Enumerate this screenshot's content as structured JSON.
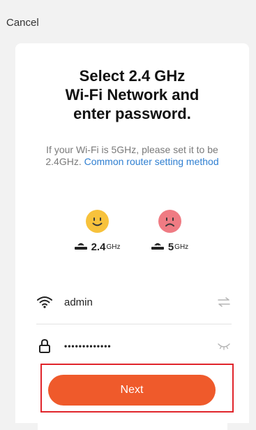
{
  "header": {
    "cancel_label": "Cancel"
  },
  "card": {
    "title_line1": "Select 2.4 GHz",
    "title_line2": "Wi-Fi Network and",
    "title_line3": "enter password.",
    "description_text": "If your Wi-Fi is 5GHz, please set it to be 2.4GHz.",
    "description_link": "Common router setting method",
    "bands": [
      {
        "value": "2.4",
        "unit": "GHz",
        "face": "happy",
        "color": "#f7c23c"
      },
      {
        "value": "5",
        "unit": "GHz",
        "face": "sad",
        "color": "#ef7b83"
      }
    ]
  },
  "form": {
    "ssid_value": "admin",
    "password_value": "•••••••••••••"
  },
  "actions": {
    "next_label": "Next"
  },
  "colors": {
    "accent": "#ef5a2b",
    "link": "#2f7fd1",
    "highlight": "#e0242b"
  }
}
